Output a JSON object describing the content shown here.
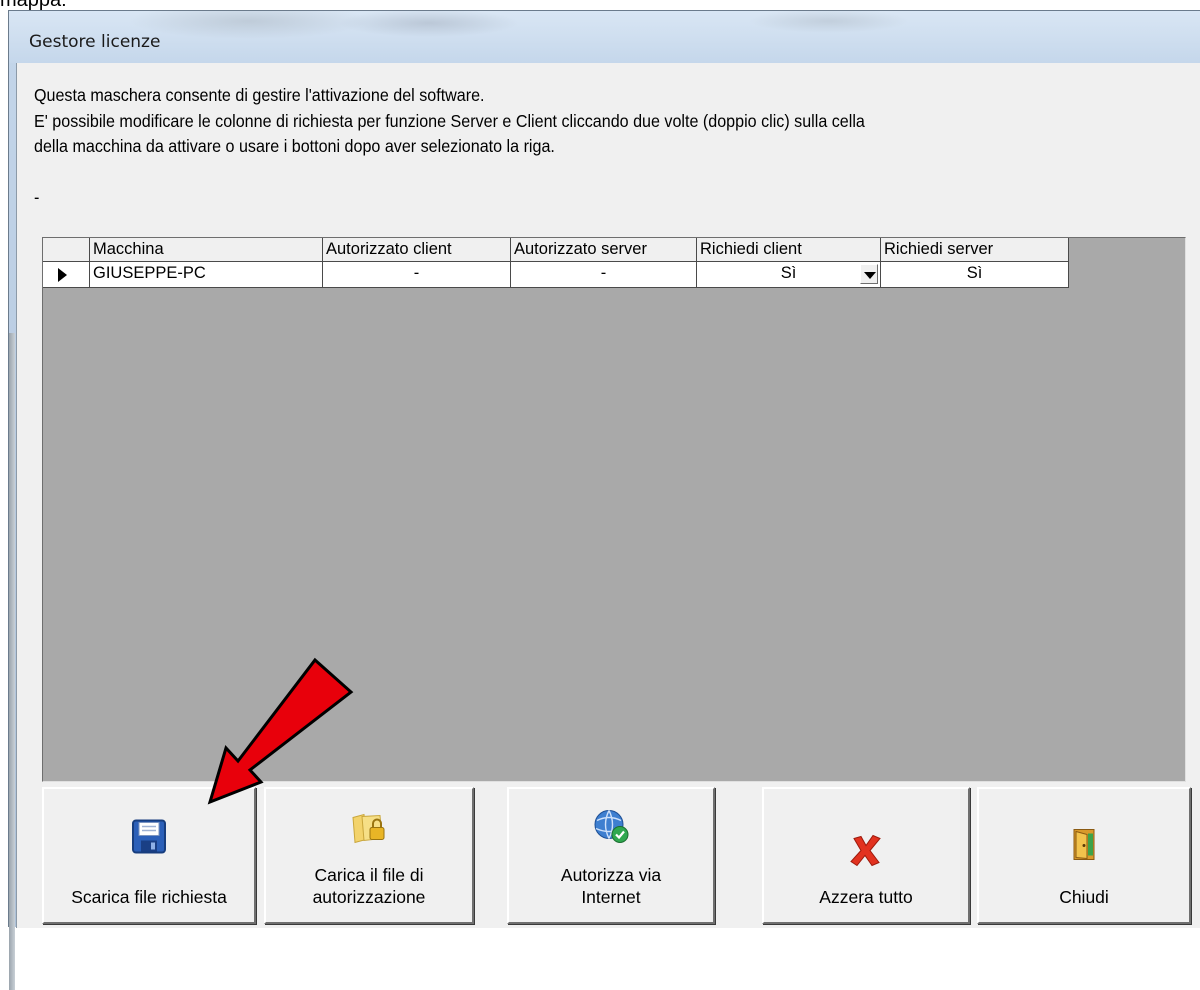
{
  "page": {
    "top_text": "mappa:"
  },
  "window": {
    "title": "Gestore licenze"
  },
  "description": {
    "line1": "Questa maschera consente di gestire l'attivazione del software.",
    "line2": "E' possibile modificare le colonne di richiesta per funzione Server e Client cliccando due volte (doppio clic) sulla cella",
    "line3": "della macchina da attivare o usare i bottoni dopo aver selezionato la riga.",
    "dash": "-"
  },
  "grid": {
    "columns": [
      "Macchina",
      "Autorizzato client",
      "Autorizzato server",
      "Richiedi client",
      "Richiedi server"
    ],
    "rows": [
      {
        "macchina": "GIUSEPPE-PC",
        "autorizzato_client": "-",
        "autorizzato_server": "-",
        "richiedi_client": "Sì",
        "richiedi_server": "Sì"
      }
    ]
  },
  "buttons": {
    "scarica": {
      "label": "Scarica file richiesta",
      "icon": "floppy-disk-icon"
    },
    "carica": {
      "label": "Carica il file di\nautorizzazione",
      "icon": "folder-lock-icon"
    },
    "autorizza": {
      "label": "Autorizza via\nInternet",
      "icon": "globe-check-icon"
    },
    "azzera": {
      "label": "Azzera tutto",
      "icon": "red-x-icon"
    },
    "chiudi": {
      "label": "Chiudi",
      "icon": "exit-door-icon"
    }
  },
  "colors": {
    "annotation_arrow": "#e8000b",
    "window_frame": "#b6c9df",
    "grid_background": "#a9a9a9"
  }
}
